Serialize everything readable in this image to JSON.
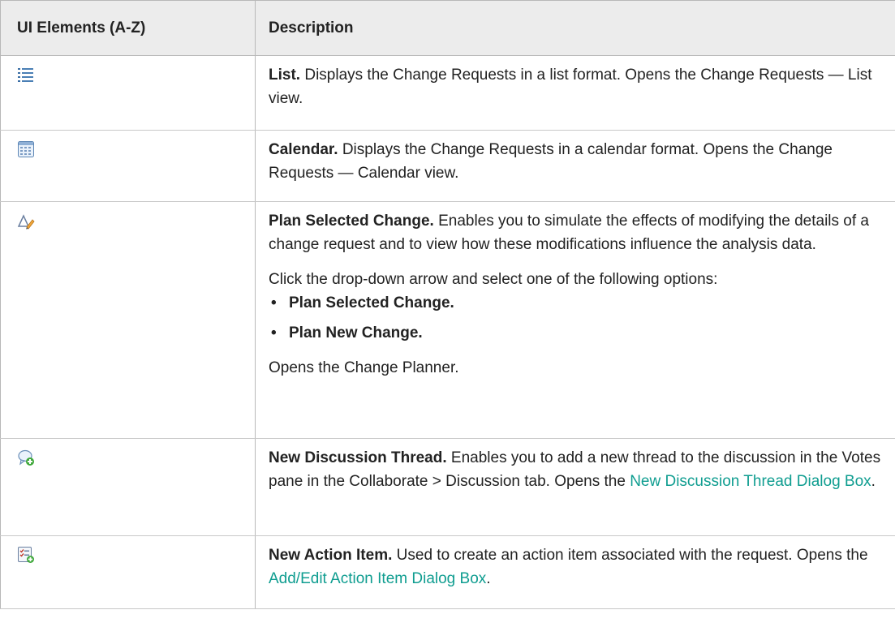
{
  "table": {
    "headers": [
      "UI Elements (A-Z)",
      "Description"
    ],
    "rows": [
      {
        "icon": "list-icon",
        "title": "List.",
        "text": " Displays the Change Requests in a list format. Opens the Change Requests — List view."
      },
      {
        "icon": "calendar-icon",
        "title": "Calendar.",
        "text": " Displays the Change Requests in a calendar format. Opens the Change Requests — Calendar view."
      },
      {
        "icon": "plan-change-icon",
        "title": "Plan Selected Change.",
        "text": " Enables you to simulate the effects of modifying the details of a change request and to view how these modifications influence the analysis data.",
        "intro": "Click the drop-down arrow and select one of the following options:",
        "options": [
          "Plan Selected Change.",
          "Plan New Change."
        ],
        "footer": "Opens the Change Planner."
      },
      {
        "icon": "discussion-thread-add-icon",
        "title": "New Discussion Thread.",
        "text": " Enables you to add a new thread to the discussion in the Votes pane in the Collaborate > Discussion tab. Opens the ",
        "link": "New Discussion Thread Dialog Box",
        "after": "."
      },
      {
        "icon": "action-item-add-icon",
        "title": "New Action Item.",
        "text": " Used to create an action item associated with the request. Opens the ",
        "link": "Add/Edit Action Item Dialog Box",
        "after": "."
      }
    ]
  },
  "colors": {
    "header_bg": "#ececec",
    "link": "#0f9d90",
    "border": "#b8b8b8"
  }
}
